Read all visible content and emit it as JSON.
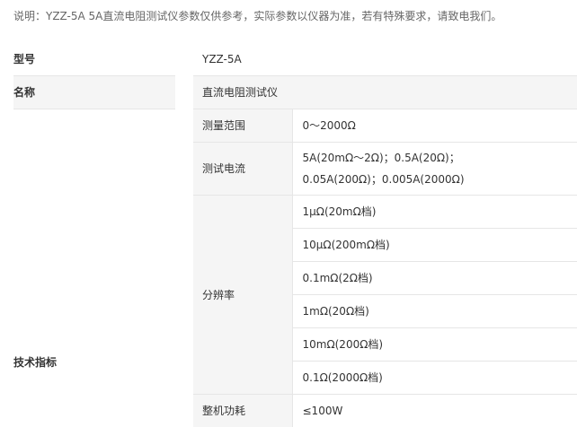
{
  "note": "说明：YZZ-5A 5A直流电阻测试仪参数仅供参考，实际参数以仪器为准，若有特殊要求，请致电我们。",
  "rows": {
    "model": {
      "label": "型号",
      "value": "YZZ-5A"
    },
    "name": {
      "label": "名称",
      "value": "直流电阻测试仪"
    },
    "tech": {
      "label": "技术指标",
      "range": {
        "label": "测量范围",
        "value": "0～2000Ω"
      },
      "current": {
        "label": "测试电流",
        "lines": [
          "5A(20mΩ～2Ω)；0.5A(20Ω)；",
          "0.05A(200Ω)；0.005A(2000Ω)"
        ]
      },
      "resolution": {
        "label": "分辨率",
        "values": [
          "1μΩ(20mΩ档)",
          "10μΩ(200mΩ档)",
          "0.1mΩ(2Ω档)",
          "1mΩ(20Ω档)",
          "10mΩ(200Ω档)",
          "0.1Ω(2000Ω档)"
        ]
      },
      "power": {
        "label": "整机功耗",
        "value": "≤100W"
      }
    }
  }
}
